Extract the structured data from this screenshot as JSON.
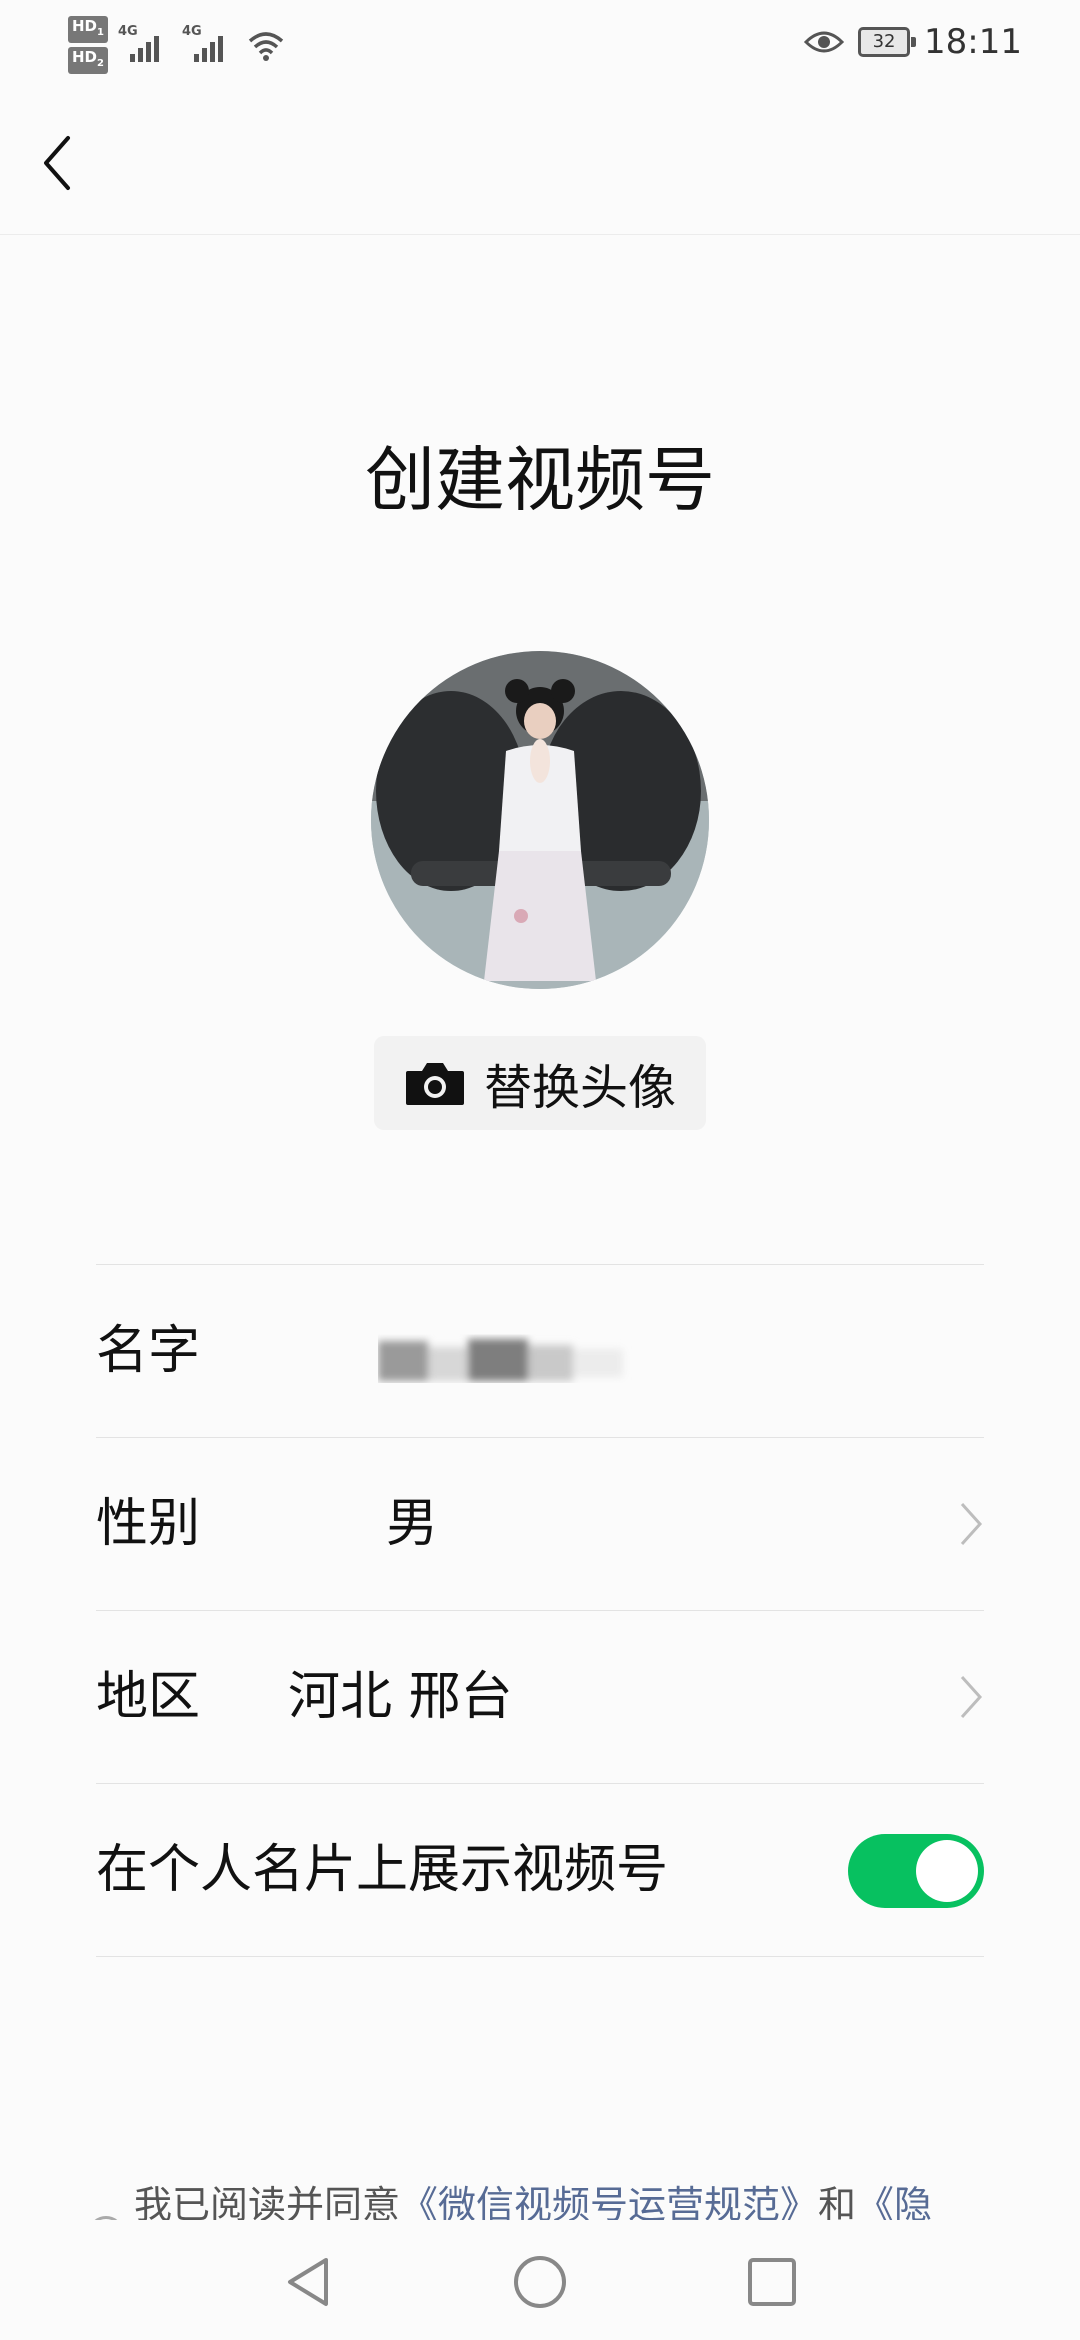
{
  "status_bar": {
    "sim1": "HD",
    "sim2": "HD",
    "network1": "4G",
    "network2": "4G",
    "battery": "32",
    "time": "18:11"
  },
  "page": {
    "title": "创建视频号",
    "replace_avatar_label": "替换头像"
  },
  "form": {
    "name_label": "名字",
    "gender_label": "性别",
    "gender_value": "男",
    "region_label": "地区",
    "region_value": "河北 邢台",
    "show_on_card_label": "在个人名片上展示视频号",
    "show_on_card_enabled": true
  },
  "agreement": {
    "prefix": "我已阅读并同意",
    "link1": "《微信视频号运营规范》",
    "and": "和",
    "link2": "《隐"
  },
  "colors": {
    "toggle_on": "#07c160",
    "link": "#576b95"
  }
}
